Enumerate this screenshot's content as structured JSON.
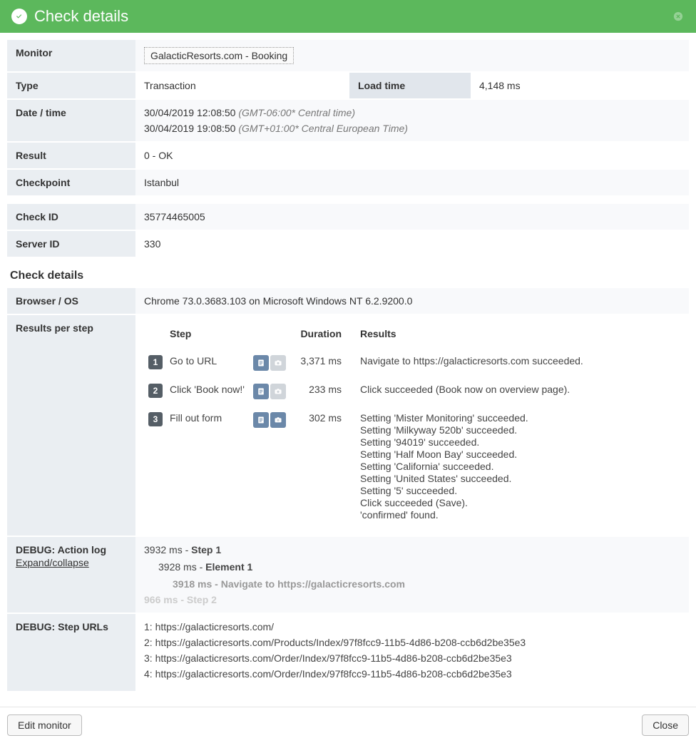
{
  "header": {
    "title": "Check details"
  },
  "rows": {
    "monitor_label": "Monitor",
    "monitor_value": "GalacticResorts.com - Booking",
    "type_label": "Type",
    "type_value": "Transaction",
    "loadtime_label": "Load time",
    "loadtime_value": "4,148 ms",
    "datetime_label": "Date / time",
    "dt1_val": "30/04/2019 12:08:50",
    "dt1_tz": "(GMT-06:00* Central time)",
    "dt2_val": "30/04/2019 19:08:50",
    "dt2_tz": "(GMT+01:00* Central European Time)",
    "result_label": "Result",
    "result_value": "0 - OK",
    "checkpoint_label": "Checkpoint",
    "checkpoint_value": "Istanbul",
    "checkid_label": "Check ID",
    "checkid_value": "35774465005",
    "serverid_label": "Server ID",
    "serverid_value": "330"
  },
  "section_title": "Check details",
  "browser_label": "Browser / OS",
  "browser_value": "Chrome 73.0.3683.103 on Microsoft Windows NT 6.2.9200.0",
  "steps_label": "Results per step",
  "steps_headers": {
    "step": "Step",
    "duration": "Duration",
    "results": "Results"
  },
  "steps": [
    {
      "num": "1",
      "name": "Go to URL",
      "duration": "3,371 ms",
      "results": [
        "Navigate to https://galacticresorts.com succeeded."
      ]
    },
    {
      "num": "2",
      "name": "Click 'Book now!'",
      "duration": "233 ms",
      "results": [
        "Click succeeded (Book now on overview page)."
      ]
    },
    {
      "num": "3",
      "name": "Fill out form",
      "duration": "302 ms",
      "results": [
        "Setting 'Mister Monitoring' succeeded.",
        "Setting 'Milkyway 520b' succeeded.",
        "Setting '94019' succeeded.",
        "Setting 'Half Moon Bay' succeeded.",
        "Setting 'California' succeeded.",
        "Setting 'United States' succeeded.",
        "Setting '5' succeeded.",
        "Click succeeded (Save).",
        "'confirmed' found."
      ]
    }
  ],
  "actionlog_label": "DEBUG: Action log",
  "expand_label": "Expand/collapse",
  "actionlog": {
    "l1_pre": "3932 ms - ",
    "l1_bold": "Step 1",
    "l2_pre": "3928 ms - ",
    "l2_bold": "Element 1",
    "l3_pre": "3918 ms - ",
    "l3_bold": "Navigate to https://galacticresorts.com",
    "l4": "966 ms - Step 2"
  },
  "stepurls_label": "DEBUG: Step URLs",
  "stepurls": [
    "1: https://galacticresorts.com/",
    "2: https://galacticresorts.com/Products/Index/97f8fcc9-11b5-4d86-b208-ccb6d2be35e3",
    "3: https://galacticresorts.com/Order/Index/97f8fcc9-11b5-4d86-b208-ccb6d2be35e3",
    "4: https://galacticresorts.com/Order/Index/97f8fcc9-11b5-4d86-b208-ccb6d2be35e3"
  ],
  "footer": {
    "edit": "Edit monitor",
    "close": "Close"
  }
}
